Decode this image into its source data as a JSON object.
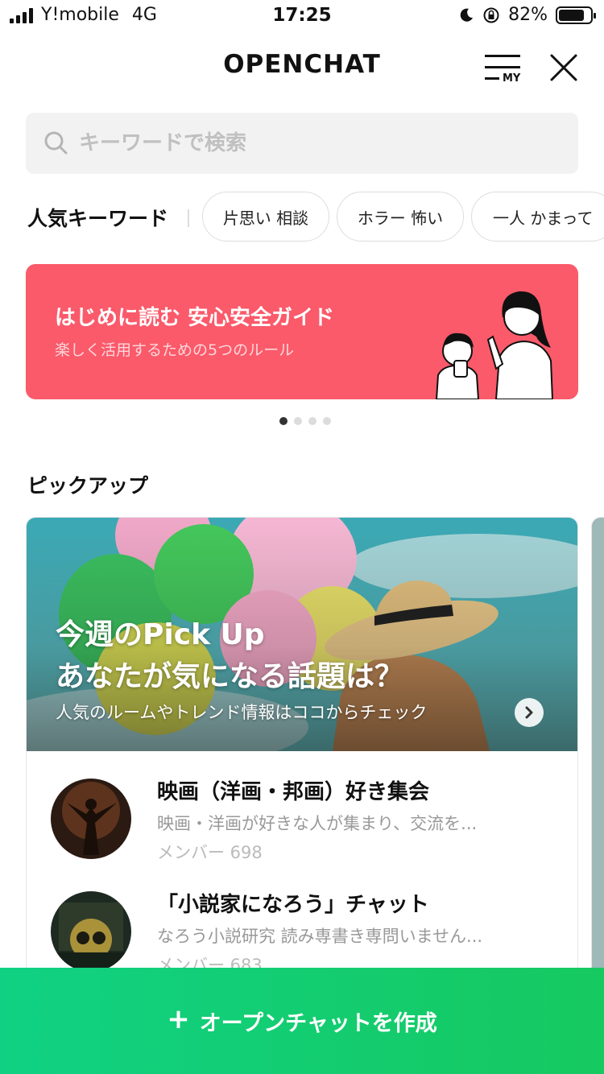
{
  "status_bar": {
    "carrier": "Y!mobile",
    "network": "4G",
    "time": "17:25",
    "battery": "82%",
    "battery_level": 0.82
  },
  "header": {
    "title": "OPENCHAT",
    "my_label": "MY"
  },
  "search": {
    "placeholder": "キーワードで検索"
  },
  "keywords": {
    "title": "人気キーワード",
    "chips": [
      "片思い 相談",
      "ホラー 怖い",
      "一人 かまって"
    ]
  },
  "banner": {
    "title": "はじめに読む 安心安全ガイド",
    "subtitle": "楽しく活用するための5つのルール",
    "page_count": 4,
    "current_page": 1
  },
  "pickup": {
    "section_title": "ピックアップ",
    "hero_title_line1": "今週のPick Up",
    "hero_title_line2": "あなたが気になる話題は？",
    "hero_subtitle": "人気のルームやトレンド情報はココからチェック",
    "rooms": [
      {
        "name": "映画（洋画・邦画）好き集会",
        "description": "映画・洋画が好きな人が集まり、交流を...",
        "members": "メンバー 698"
      },
      {
        "name": "「小説家になろう」チャット",
        "description": "なろう小説研究 読み専書き専問いません...",
        "members": "メンバー 683"
      }
    ]
  },
  "create_button": {
    "label": "オープンチャットを作成"
  },
  "colors": {
    "banner": "#fa5a6a",
    "accent_green": "#10d183"
  }
}
